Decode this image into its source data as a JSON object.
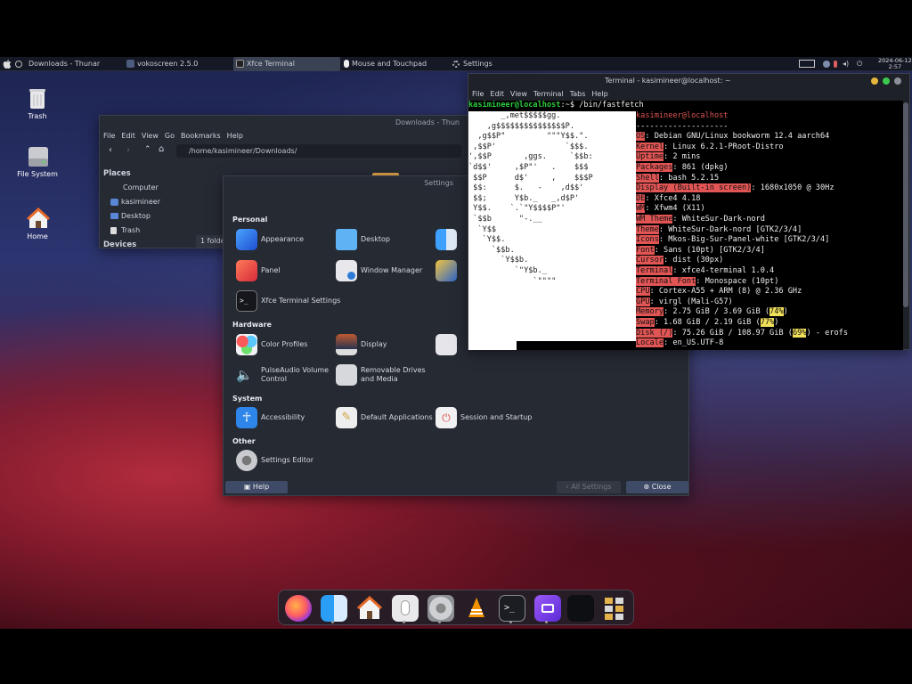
{
  "topbar": {
    "windows": [
      {
        "label": "Downloads - Thunar"
      },
      {
        "label": "vokoscreen 2.5.0"
      },
      {
        "label": "Xfce Terminal"
      },
      {
        "label": "Mouse and Touchpad"
      },
      {
        "label": "Settings"
      }
    ],
    "clock_date": "2024-06-12",
    "clock_time": "2:57"
  },
  "desktop_icons": [
    {
      "label": "Trash",
      "icon": "trash-icon"
    },
    {
      "label": "File System",
      "icon": "drive-icon"
    },
    {
      "label": "Home",
      "icon": "home-icon"
    }
  ],
  "thunar": {
    "title": "Downloads - Thun",
    "menu": [
      "File",
      "Edit",
      "View",
      "Go",
      "Bookmarks",
      "Help"
    ],
    "path": "/home/kasimineer/Downloads/",
    "places_header": "Places",
    "places": [
      "Computer",
      "kasimineer",
      "Desktop",
      "Trash"
    ],
    "devices_header": "Devices",
    "status": "1 folde"
  },
  "settings": {
    "title": "Settings",
    "categories": {
      "personal": "Personal",
      "hardware": "Hardware",
      "system": "System",
      "other": "Other"
    },
    "items": {
      "appearance": "Appearance",
      "desktop": "Desktop",
      "panel": "Panel",
      "window_manager": "Window Manager",
      "xfce_terminal": "Xfce Terminal Settings",
      "color_profiles": "Color Profiles",
      "display": "Display",
      "pulseaudio": "PulseAudio Volume Control",
      "removable": "Removable Drives and Media",
      "accessibility": "Accessibility",
      "default_apps": "Default Applications",
      "session": "Session and Startup",
      "settings_editor": "Settings Editor"
    },
    "help_button": "Help",
    "all_settings_button": "All Settings",
    "close_button": "Close"
  },
  "terminal": {
    "title": "Terminal - kasimineer@localhost: ~",
    "menu": [
      "File",
      "Edit",
      "View",
      "Terminal",
      "Tabs",
      "Help"
    ],
    "prompt": "kasimineer@localhost",
    "prompt_suffix": ":~$ /bin/fastfetch",
    "logo": [
      "       _,met$$$$$gg.",
      "    ,g$$$$$$$$$$$$$$$P.",
      "  ,g$$P\"         \"\"\"Y$$.\".",
      " ,$$P'               `$$$.",
      "',$$P       ,ggs.     `$$b:",
      "`d$$'     ,$P\"'   .    $$$",
      " $$P      d$'     ,    $$$P",
      " $$:      $.   -    ,d$$'",
      " $$;      Y$b._   _,d$P'",
      " Y$$.    `.`\"Y$$$$P\"'",
      " `$$b      \"-.__",
      "  `Y$$",
      "   `Y$$.",
      "     `$$b.",
      "       `Y$$b.",
      "          `\"Y$b._",
      "              `\"\"\"\""
    ],
    "user_host": "kasimineer@localhost",
    "separator": "--------------------",
    "info": [
      {
        "key": "OS",
        "value": ": Debian GNU/Linux bookworm 12.4 aarch64"
      },
      {
        "key": "Kernel",
        "value": ": Linux 6.2.1-PRoot-Distro"
      },
      {
        "key": "Uptime",
        "value": ": 2 mins"
      },
      {
        "key": "Packages",
        "value": ": 861 (dpkg)"
      },
      {
        "key": "Shell",
        "value": ": bash 5.2.15"
      },
      {
        "key": "Display (Built-in screen)",
        "value": ": 1680x1050 @ 30Hz"
      },
      {
        "key": "DE",
        "value": ": Xfce4 4.18"
      },
      {
        "key": "WM",
        "value": ": Xfwm4 (X11)"
      },
      {
        "key": "WM Theme",
        "value": ": WhiteSur-Dark-nord"
      },
      {
        "key": "Theme",
        "value": ": WhiteSur-Dark-nord [GTK2/3/4]"
      },
      {
        "key": "Icons",
        "value": ": Mkos-Big-Sur-Panel-white [GTK2/3/4]"
      },
      {
        "key": "Font",
        "value": ": Sans (10pt) [GTK2/3/4]"
      },
      {
        "key": "Cursor",
        "value": ": dist (30px)"
      },
      {
        "key": "Terminal",
        "value": ": xfce4-terminal 1.0.4"
      },
      {
        "key": "Terminal Font",
        "value": ": Monospace (10pt)"
      },
      {
        "key": "CPU",
        "value": ": Cortex-A55 + ARM (8) @ 2.36 GHz"
      },
      {
        "key": "GPU",
        "value": ": virgl (Mali-G57)"
      },
      {
        "key": "Memory",
        "value": ": 2.75 GiB / 3.69 GiB (",
        "pct": "74%",
        "end": ")"
      },
      {
        "key": "Swap",
        "value": ": 1.68 GiB / 2.19 GiB (",
        "pct": "77%",
        "end": ")"
      },
      {
        "key": "Disk (/)",
        "value": ": 75.26 GiB / 108.97 GiB (",
        "pct": "69%",
        "end": ") - erofs"
      },
      {
        "key": "Locale",
        "value": ": en_US.UTF-8"
      }
    ],
    "colors": {
      "label": "#e25555",
      "percent_highlight": "#f1e05a",
      "prompt": "#2ecc40"
    }
  },
  "dock": {
    "items": [
      "firefox-icon",
      "finder-icon",
      "home-folder-icon",
      "mouse-icon",
      "settings-icon",
      "vlc-icon",
      "terminal-icon",
      "screen-recorder-icon",
      "blank-window-icon",
      "app-grid-icon"
    ]
  }
}
